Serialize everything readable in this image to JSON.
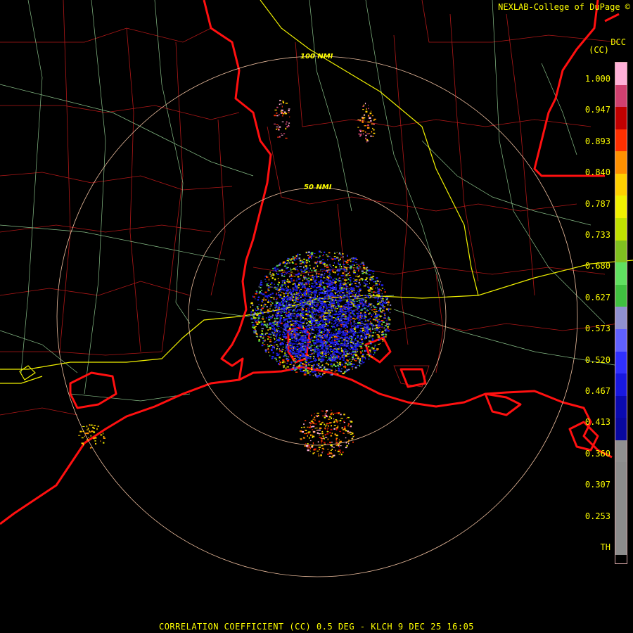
{
  "credit": "NEXLAB-College of DuPage ©",
  "footer": "CORRELATION COEFFICIENT (CC) 0.5 DEG - KLCH 9 DEC 25 16:05",
  "legend": {
    "product_short": "DCC",
    "product_unit": "(CC)",
    "labels": [
      "1.000",
      "0.947",
      "0.893",
      "0.840",
      "0.787",
      "0.733",
      "0.680",
      "0.627",
      "0.573",
      "0.520",
      "0.467",
      "0.413",
      "0.360",
      "0.307",
      "0.253",
      "TH"
    ],
    "colors": [
      "#ffb0d8",
      "#d04070",
      "#c00000",
      "#ff3000",
      "#ff9000",
      "#ffd000",
      "#f0f000",
      "#c0e000",
      "#80c020",
      "#60e060",
      "#40c040",
      "#9090d0",
      "#6060ff",
      "#3030ff",
      "#1818e0",
      "#0a0ab0",
      "#0808a0",
      "#909090",
      "#8c8c8c"
    ]
  },
  "range_rings": [
    {
      "label": "50 NMI"
    },
    {
      "label": "100 NMI"
    }
  ],
  "colors": {
    "background": "#000000",
    "coast": "#ff1010",
    "county": "#b01818",
    "highway": "#a0e0a0",
    "interstate": "#f0f000",
    "ring": "#f0c0a0"
  }
}
